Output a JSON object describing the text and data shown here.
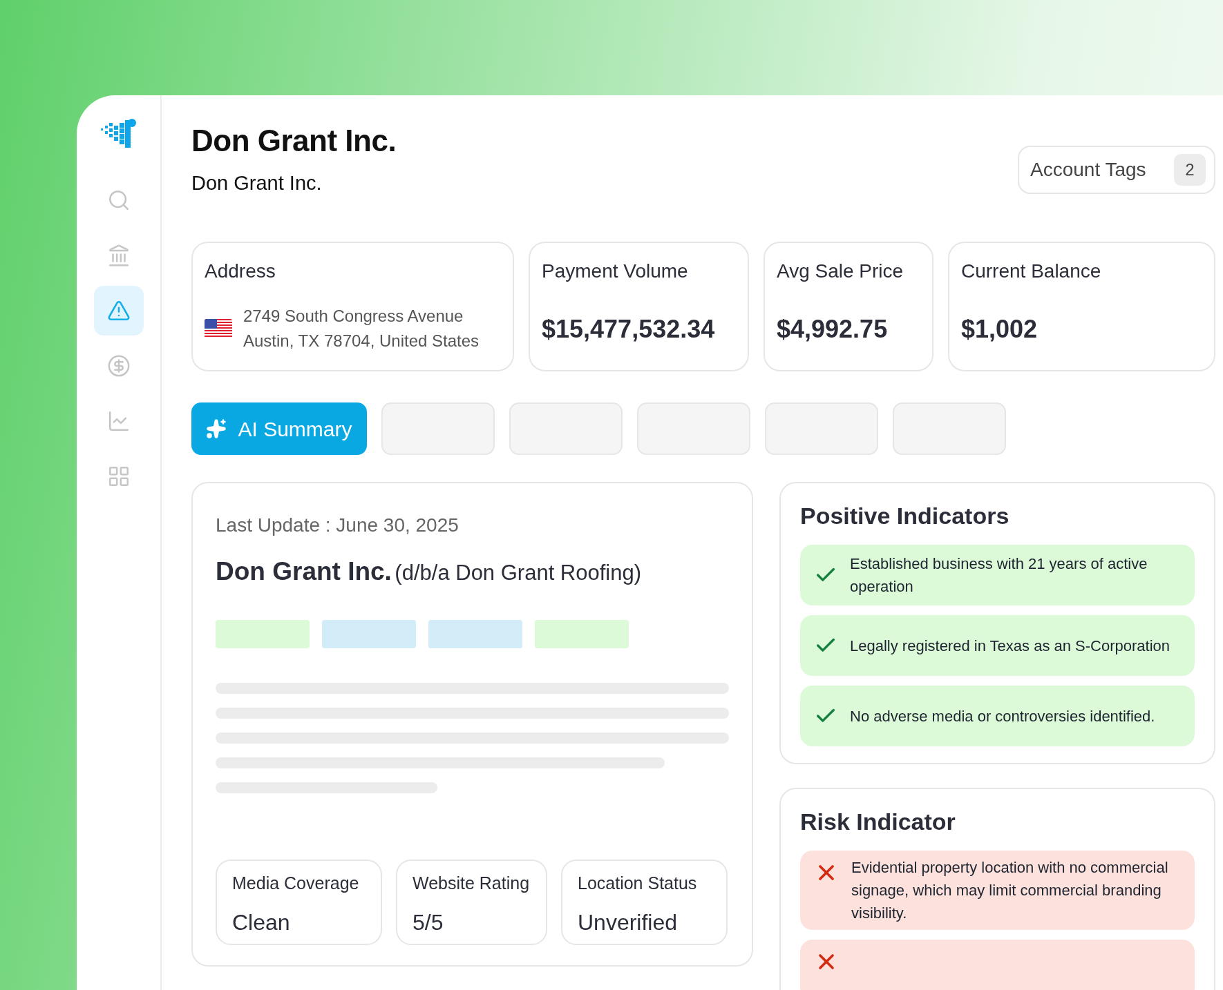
{
  "sidebar": {
    "items": [
      {
        "kind": "search",
        "selected": false
      },
      {
        "kind": "bank",
        "selected": false
      },
      {
        "kind": "alert",
        "selected": true
      },
      {
        "kind": "dollar",
        "selected": false
      },
      {
        "kind": "chart",
        "selected": false
      },
      {
        "kind": "grid",
        "selected": false
      }
    ]
  },
  "header": {
    "title": "Don Grant Inc.",
    "subtitle": "Don Grant Inc.",
    "account_tags": {
      "label": "Account Tags",
      "count": "2"
    }
  },
  "cards": [
    {
      "kind": "address",
      "label": "Address",
      "lines": [
        "2749 South Congress Avenue",
        "Austin, TX 78704, United States"
      ]
    },
    {
      "kind": "metric",
      "label": "Payment Volume",
      "value": "$15,477,532.34"
    },
    {
      "kind": "metric",
      "label": "Avg Sale Price",
      "value": "$4,992.75"
    },
    {
      "kind": "metric",
      "label": "Current Balance",
      "value": "$1,002"
    }
  ],
  "tabs": [
    {
      "label": "AI Summary",
      "selected": true
    },
    {
      "selected": false
    },
    {
      "selected": false
    },
    {
      "selected": false
    },
    {
      "selected": false
    },
    {
      "selected": false
    }
  ],
  "summary": {
    "last_update": "Last Update : June 30, 2025",
    "name": "Don Grant Inc.",
    "dba": "(d/b/a Don Grant Roofing)",
    "chips": [
      {
        "color": "#dcfad8"
      },
      {
        "color": "#d2ecf8"
      },
      {
        "color": "#d2ecf8"
      },
      {
        "color": "#dcfad8"
      }
    ],
    "stats": [
      {
        "label": "Media Coverage",
        "value": "Clean"
      },
      {
        "label": "Website Rating",
        "value": "5/5"
      },
      {
        "label": "Location Status",
        "value": "Unverified"
      }
    ]
  },
  "positive": {
    "title": "Positive Indicators",
    "items": [
      {
        "kind": "positive",
        "text": "Established business with 21 years of active operation"
      },
      {
        "kind": "positive",
        "text": "Legally registered in Texas as an S-Corporation"
      },
      {
        "kind": "positive",
        "text": "No adverse media or controversies identified."
      }
    ]
  },
  "risk": {
    "title": "Risk Indicator",
    "items": [
      {
        "kind": "risk",
        "text": "Evidential property location with no commercial signage, which may limit commercial branding visibility."
      },
      {
        "kind": "risk"
      }
    ]
  }
}
